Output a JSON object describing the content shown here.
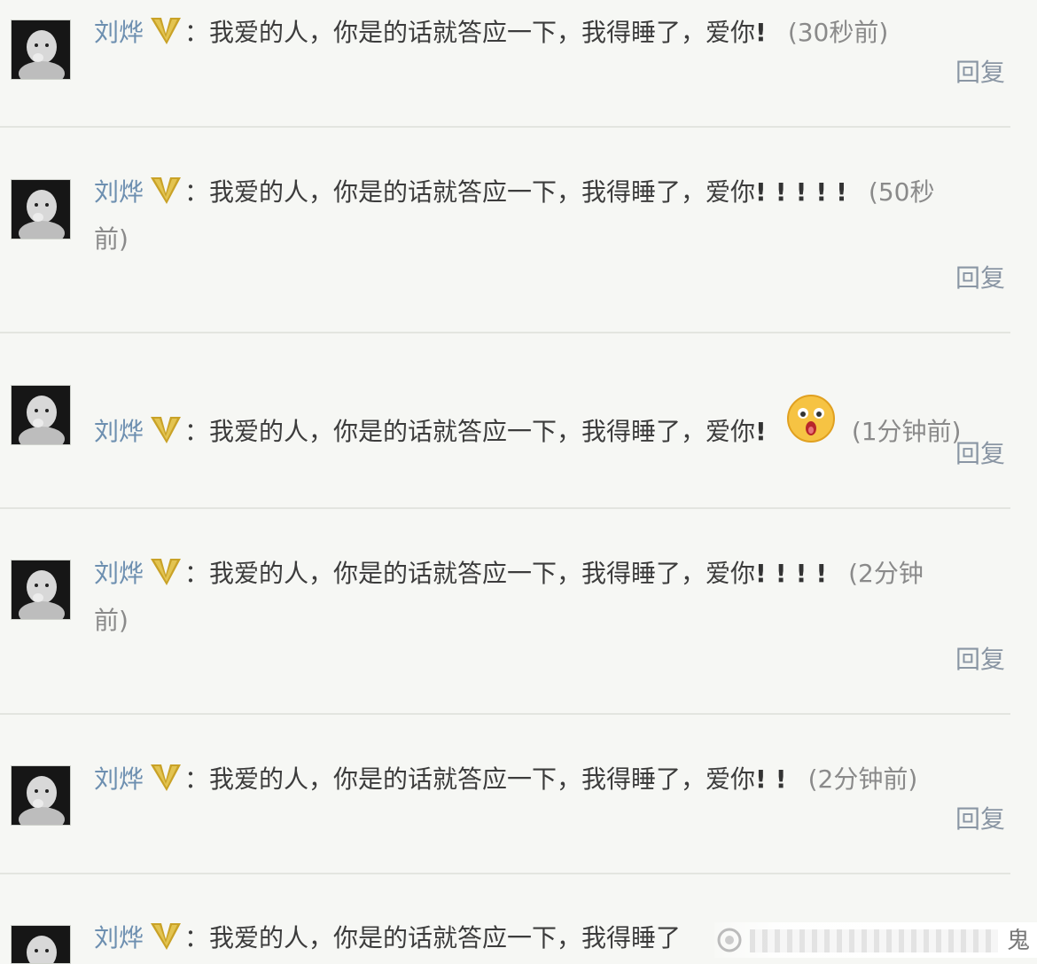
{
  "comments": [
    {
      "username": "刘烨",
      "text": "：我爱的人，你是的话就答应一下，我得睡了，爱你",
      "exclaims": "!",
      "time_line1": "(30秒前)",
      "time_line2": "",
      "reply_label": "回复"
    },
    {
      "username": "刘烨",
      "text": "：我爱的人，你是的话就答应一下，我得睡了，爱你",
      "exclaims": "!!!!!",
      "time_line1": "(50秒",
      "time_line2": "前)",
      "reply_label": "回复"
    },
    {
      "username": "刘烨",
      "text": "：我爱的人，你是的话就答应一下，我得睡了，爱你",
      "exclaims": "!",
      "time_line1": "(1分钟前)",
      "time_line2": "",
      "reply_label": "回复",
      "emoji": "shocked-face"
    },
    {
      "username": "刘烨",
      "text": "：我爱的人，你是的话就答应一下，我得睡了，爱你",
      "exclaims": "!!!!",
      "time_line1": "(2分钟",
      "time_line2": "前)",
      "reply_label": "回复"
    },
    {
      "username": "刘烨",
      "text": "：我爱的人，你是的话就答应一下，我得睡了，爱你",
      "exclaims": "!!",
      "time_line1": "(2分钟前)",
      "time_line2": "",
      "reply_label": "回复"
    },
    {
      "username": "刘烨",
      "text": "：我爱的人，你是的话就答应一下，我得睡了",
      "exclaims": "",
      "time_line1": "",
      "time_line2": "",
      "reply_label": ""
    }
  ],
  "watermark": {
    "char": "鬼"
  },
  "colors": {
    "username": "#6d8fb0",
    "body_text": "#3c3c3c",
    "time_text": "#8a8a8a",
    "reply_text": "#8a96a4",
    "verified_badge": "#c9a227",
    "background": "#f6f7f4"
  },
  "icons": {
    "verified": "v-badge-icon",
    "avatar": "baby-photo-avatar"
  }
}
